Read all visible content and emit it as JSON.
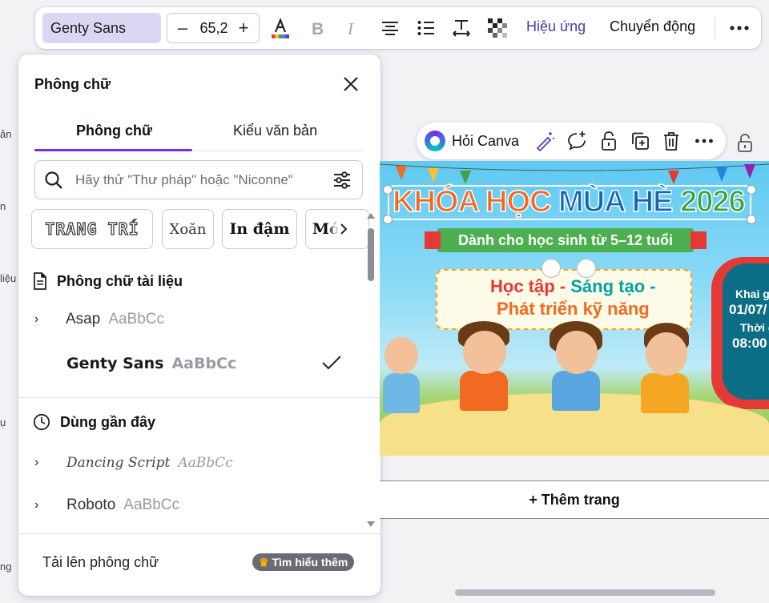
{
  "left_strip": [
    "ản",
    "n",
    "liệu",
    "ụ",
    "ng"
  ],
  "toolbar": {
    "font_name": "Genty Sans",
    "font_size": "65,2",
    "minus": "–",
    "plus": "+",
    "effects": "Hiệu ứng",
    "animate": "Chuyển động",
    "text_color_bar": [
      "#e53935",
      "#fbc02d",
      "#43a047",
      "#1e88e5",
      "#8e24aa"
    ]
  },
  "panel": {
    "title": "Phông chữ",
    "tabs": [
      "Phông chữ",
      "Kiểu văn bản"
    ],
    "search_placeholder": "Hãy thử \"Thư pháp\" hoặc \"Niconne\"",
    "chips": [
      "TRANG TRÍ",
      "Xoăn",
      "In đậm",
      "Mớ"
    ],
    "doc_fonts_heading": "Phông chữ tài liệu",
    "doc_fonts": [
      {
        "name": "Asap",
        "sample": "AaBbCc",
        "expandable": true,
        "selected": false
      },
      {
        "name": "Genty Sans",
        "sample": "AaBbCc",
        "expandable": false,
        "selected": true
      }
    ],
    "recent_heading": "Dùng gần đây",
    "recent_fonts": [
      {
        "name": "Dancing Script",
        "sample": "AaBbCc",
        "expandable": true
      },
      {
        "name": "Roboto",
        "sample": "AaBbCc",
        "expandable": true
      }
    ],
    "upload_label": "Tải lên phông chữ",
    "learn_more": "Tìm hiểu thêm"
  },
  "canvas": {
    "ask_canva": "Hỏi Canva",
    "add_page": "+ Thêm trang",
    "design": {
      "title_parts": [
        "KHÓA HỌC ",
        "MÙA HÈ ",
        "2026"
      ],
      "ribbon": "Dành cho học sinh từ 5–12 tuổi",
      "line1_a": "Học tập - ",
      "line1_b": "Sáng tạo -",
      "line2": "Phát triển kỹ năng",
      "side_1": "Khai g",
      "side_2": "01/07/",
      "side_3": "Thời g",
      "side_4": "08:00"
    }
  },
  "colors": {
    "accent": "#7d2ae8",
    "font_select_bg": "#ddd6f3",
    "title_orange": "#f26a21",
    "title_blue": "#1565b8",
    "title_green": "#3aa33b"
  }
}
